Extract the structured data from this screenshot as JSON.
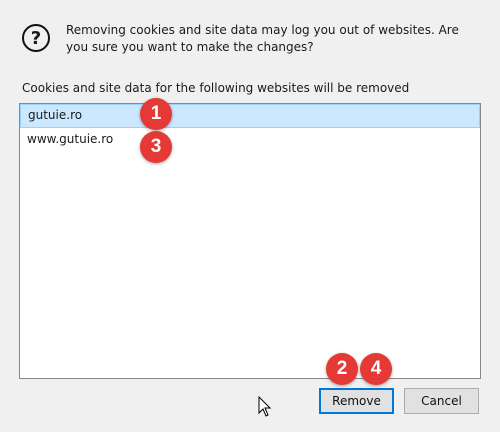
{
  "dialog": {
    "message": "Removing cookies and site data may log you out of websites. Are you sure you want to make the changes?",
    "list_caption": "Cookies and site data for the following websites will be removed",
    "sites": [
      "gutuie.ro",
      "www.gutuie.ro"
    ],
    "buttons": {
      "remove": "Remove",
      "cancel": "Cancel"
    },
    "icon": "question-icon"
  },
  "annotations": [
    "1",
    "2",
    "3",
    "4"
  ],
  "colors": {
    "badge": "#e53935",
    "selection": "#cce8ff",
    "default_button_border": "#0078d7"
  }
}
